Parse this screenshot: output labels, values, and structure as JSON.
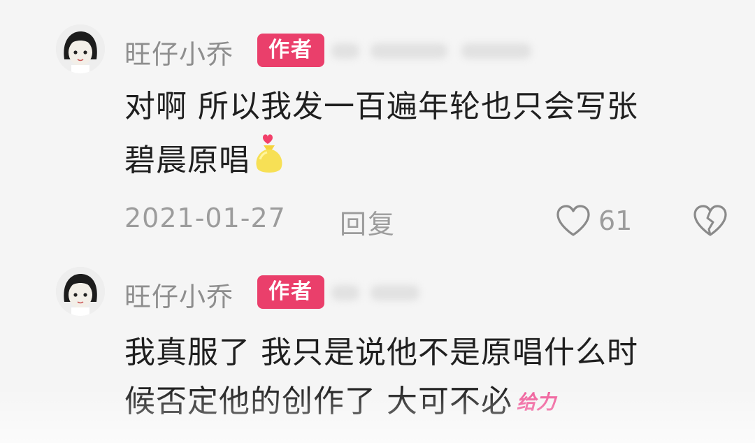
{
  "comments": [
    {
      "username": "旺仔小乔",
      "badge": "作者",
      "lines": [
        "对啊 所以我发一百遍年轮也只会写张",
        "碧晨原唱"
      ],
      "emoji": "gold-bag",
      "date": "2021-01-27",
      "reply_label": "回复",
      "like_count": "61"
    },
    {
      "username": "旺仔小乔",
      "badge": "作者",
      "lines": [
        "我真服了 我只是说他不是原唱什么时",
        "候否定他的创作了 大可不必"
      ],
      "sticker_text": "给力"
    }
  ],
  "colors": {
    "badge_bg": "#ea3f6b",
    "muted_text": "#9c9c9c",
    "body_text": "#1f1f1f",
    "sticker": "#ef5a98"
  },
  "icons": [
    "avatar",
    "heart-outline-icon",
    "broken-heart-icon",
    "gold-bag-emoji"
  ]
}
